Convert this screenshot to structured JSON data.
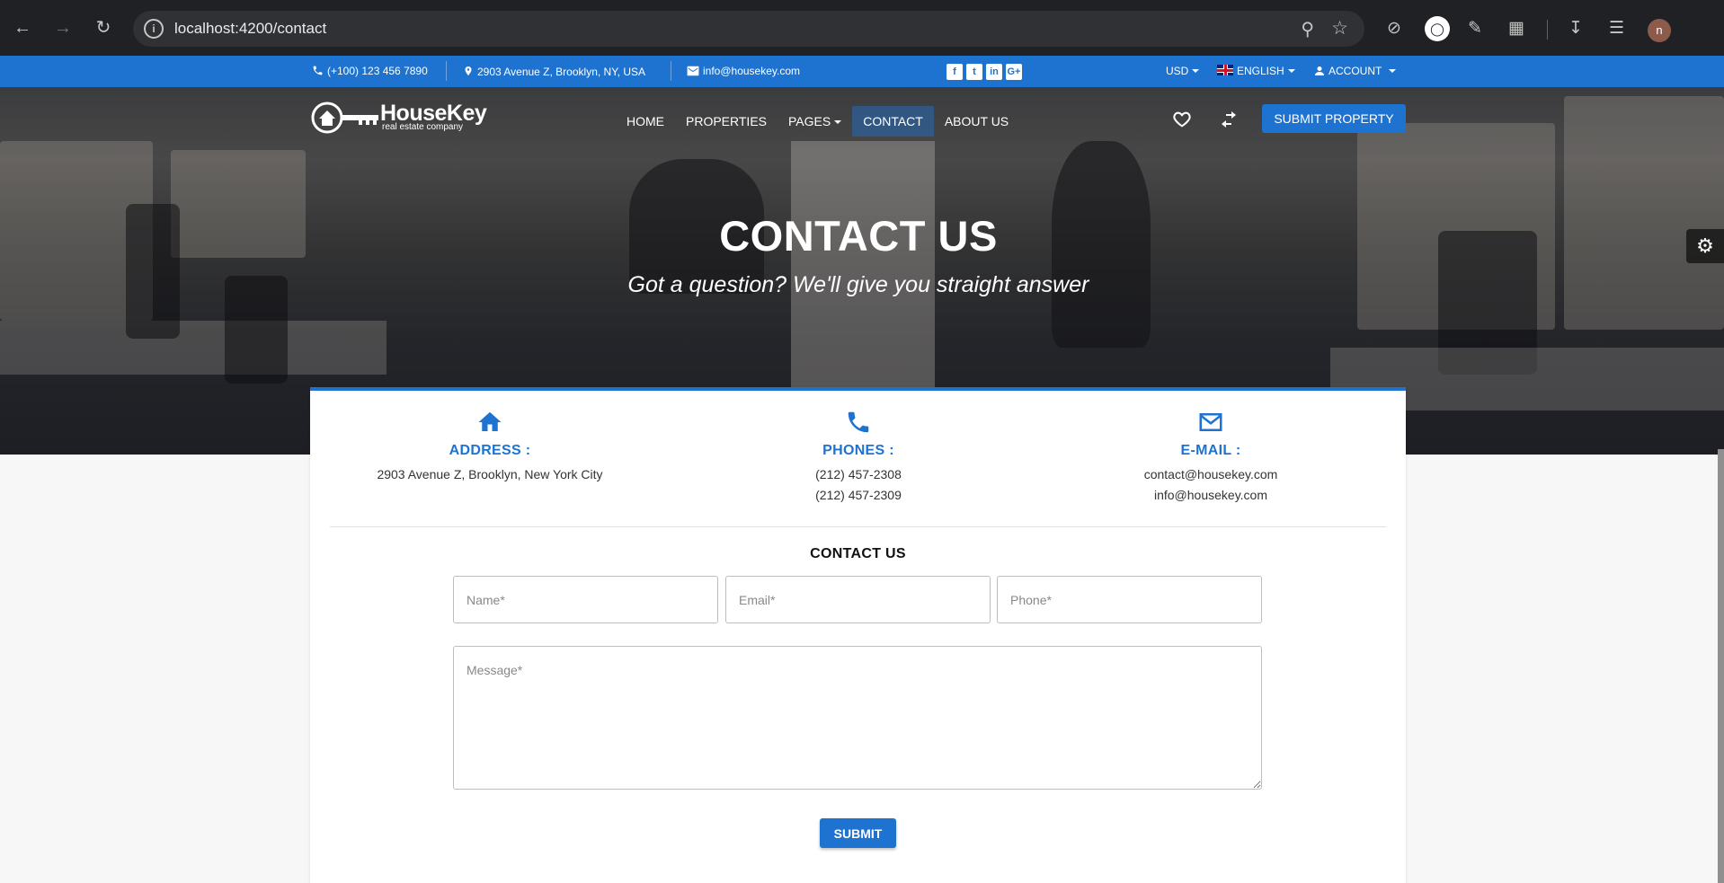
{
  "browser": {
    "url": "localhost:4200/contact",
    "avatar_letter": "n"
  },
  "topbar": {
    "phone": "(+100) 123 456 7890",
    "address": "2903 Avenue Z, Brooklyn, NY, USA",
    "email": "info@housekey.com",
    "social": [
      "f",
      "t",
      "in",
      "G+"
    ],
    "currency": "USD",
    "language": "ENGLISH",
    "account": "ACCOUNT"
  },
  "brand": {
    "name": "HouseKey",
    "tagline": "real estate company"
  },
  "nav": {
    "items": [
      "HOME",
      "PROPERTIES",
      "PAGES",
      "CONTACT",
      "ABOUT US"
    ],
    "active": "CONTACT",
    "submit_property": "SUBMIT PROPERTY"
  },
  "hero": {
    "title": "CONTACT US",
    "subtitle": "Got a question? We'll give you straight answer"
  },
  "contact_info": {
    "address": {
      "label": "ADDRESS :",
      "lines": [
        "2903 Avenue Z, Brooklyn, New York City"
      ]
    },
    "phones": {
      "label": "PHONES :",
      "lines": [
        "(212) 457-2308",
        "(212) 457-2309"
      ]
    },
    "email": {
      "label": "E-MAIL :",
      "lines": [
        "contact@housekey.com",
        "info@housekey.com"
      ]
    }
  },
  "form": {
    "title": "CONTACT US",
    "name_placeholder": "Name*",
    "email_placeholder": "Email*",
    "phone_placeholder": "Phone*",
    "message_placeholder": "Message*",
    "submit": "SUBMIT"
  },
  "colors": {
    "primary": "#1e73d1",
    "chrome": "#202124"
  }
}
